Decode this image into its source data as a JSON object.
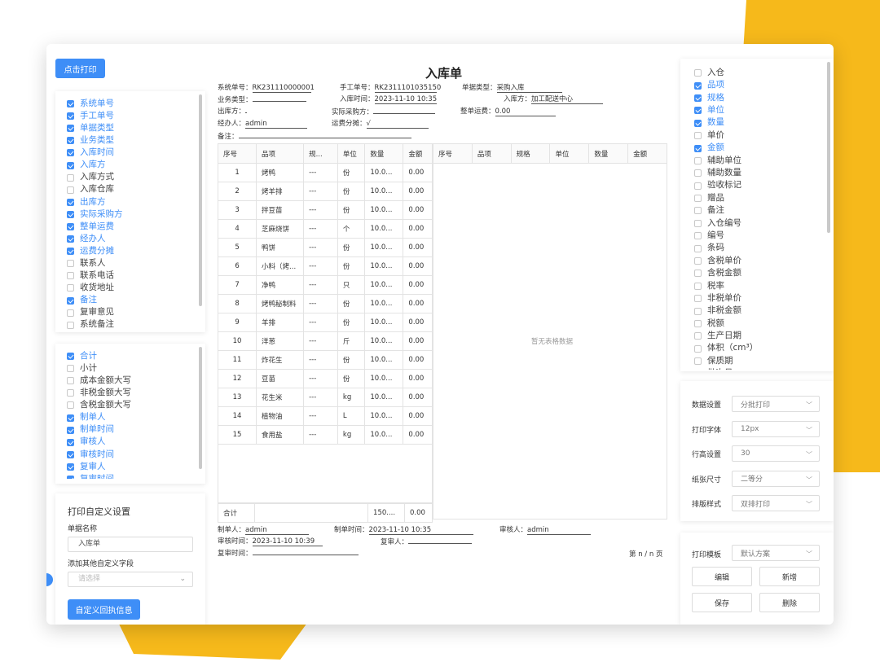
{
  "print_button": "点击打印",
  "left_top_list": [
    {
      "label": "系统单号",
      "on": true
    },
    {
      "label": "手工单号",
      "on": true
    },
    {
      "label": "单据类型",
      "on": true
    },
    {
      "label": "业务类型",
      "on": true
    },
    {
      "label": "入库时间",
      "on": true
    },
    {
      "label": "入库方",
      "on": true
    },
    {
      "label": "入库方式",
      "on": false
    },
    {
      "label": "入库仓库",
      "on": false
    },
    {
      "label": "出库方",
      "on": true
    },
    {
      "label": "实际采购方",
      "on": true
    },
    {
      "label": "整单运费",
      "on": true
    },
    {
      "label": "经办人",
      "on": true
    },
    {
      "label": "运费分摊",
      "on": true
    },
    {
      "label": "联系人",
      "on": false
    },
    {
      "label": "联系电话",
      "on": false
    },
    {
      "label": "收货地址",
      "on": false
    },
    {
      "label": "备注",
      "on": true
    },
    {
      "label": "复审意见",
      "on": false
    },
    {
      "label": "系统备注",
      "on": false
    }
  ],
  "left_bottom_list": [
    {
      "label": "合计",
      "on": true
    },
    {
      "label": "小计",
      "on": false
    },
    {
      "label": "成本金额大写",
      "on": false
    },
    {
      "label": "非税金额大写",
      "on": false
    },
    {
      "label": "含税金额大写",
      "on": false
    },
    {
      "label": "制单人",
      "on": true
    },
    {
      "label": "制单时间",
      "on": true
    },
    {
      "label": "审核人",
      "on": true
    },
    {
      "label": "审核时间",
      "on": true
    },
    {
      "label": "复审人",
      "on": true
    },
    {
      "label": "复审时间",
      "on": true
    }
  ],
  "custom": {
    "title": "打印自定义设置",
    "name_label": "单据名称",
    "name_value": "入库单",
    "extra_label": "添加其他自定义字段",
    "extra_placeholder": "请选择",
    "button": "自定义回执信息"
  },
  "doc": {
    "title": "入库单",
    "fields": {
      "sys_no_label": "系统单号：",
      "sys_no": "RK231110000001",
      "manual_no_label": "手工单号：",
      "manual_no": "RK2311101035150",
      "doc_type_label": "单据类型：",
      "doc_type": "采购入库",
      "biz_type_label": "业务类型：",
      "biz_type": "",
      "in_time_label": "入库时间：",
      "in_time": "2023-11-10 10:35",
      "in_party_label": "入库方：",
      "in_party": "加工配送中心",
      "out_party_label": "出库方：",
      "out_party": "",
      "buyer_label": "实际采购方：",
      "buyer": "",
      "freight_label": "整单运费：",
      "freight": "0.00",
      "handler_label": "经办人：",
      "handler": "admin",
      "freight_share_label": "运费分摊：",
      "freight_share": "√",
      "remark_label": "备注：",
      "remark": ""
    },
    "headers": [
      "序号",
      "品项",
      "规...",
      "单位",
      "数量",
      "金额"
    ],
    "headers2": [
      "序号",
      "品项",
      "规格",
      "单位",
      "数量",
      "金额"
    ],
    "rows": [
      [
        "1",
        "烤鸭",
        "---",
        "份",
        "10.0...",
        "0.00"
      ],
      [
        "2",
        "烤羊排",
        "---",
        "份",
        "10.0...",
        "0.00"
      ],
      [
        "3",
        "拌豆苗",
        "---",
        "份",
        "10.0...",
        "0.00"
      ],
      [
        "4",
        "芝麻烧饼",
        "---",
        "个",
        "10.0...",
        "0.00"
      ],
      [
        "5",
        "鸭饼",
        "---",
        "份",
        "10.0...",
        "0.00"
      ],
      [
        "6",
        "小料（烤...",
        "---",
        "份",
        "10.0...",
        "0.00"
      ],
      [
        "7",
        "净鸭",
        "---",
        "只",
        "10.0...",
        "0.00"
      ],
      [
        "8",
        "烤鸭秘制料",
        "---",
        "份",
        "10.0...",
        "0.00"
      ],
      [
        "9",
        "羊排",
        "---",
        "份",
        "10.0...",
        "0.00"
      ],
      [
        "10",
        "洋葱",
        "---",
        "斤",
        "10.0...",
        "0.00"
      ],
      [
        "11",
        "炸花生",
        "---",
        "份",
        "10.0...",
        "0.00"
      ],
      [
        "12",
        "豆苗",
        "---",
        "份",
        "10.0...",
        "0.00"
      ],
      [
        "13",
        "花生米",
        "---",
        "kg",
        "10.0...",
        "0.00"
      ],
      [
        "14",
        "植物油",
        "---",
        "L",
        "10.0...",
        "0.00"
      ],
      [
        "15",
        "食用盐",
        "---",
        "kg",
        "10.0...",
        "0.00"
      ]
    ],
    "total_label": "合计",
    "total_qty": "150....",
    "total_amount": "0.00",
    "empty_text": "暂无表格数据",
    "footer": {
      "maker_label": "制单人：",
      "maker": "admin",
      "make_time_label": "制单时间：",
      "make_time": "2023-11-10 10:35",
      "auditor_label": "审核人：",
      "auditor": "admin",
      "audit_time_label": "审核时间：",
      "audit_time": "2023-11-10 10:39",
      "reviewer_label": "复审人：",
      "reviewer": "",
      "review_time_label": "复审时间：",
      "review_time": "",
      "page": "第 n / n 页"
    }
  },
  "right_list": [
    {
      "label": "入仓",
      "on": false
    },
    {
      "label": "品项",
      "on": true
    },
    {
      "label": "规格",
      "on": true
    },
    {
      "label": "单位",
      "on": true
    },
    {
      "label": "数量",
      "on": true
    },
    {
      "label": "单价",
      "on": false
    },
    {
      "label": "金额",
      "on": true
    },
    {
      "label": "辅助单位",
      "on": false
    },
    {
      "label": "辅助数量",
      "on": false
    },
    {
      "label": "验收标记",
      "on": false
    },
    {
      "label": "赠品",
      "on": false
    },
    {
      "label": "备注",
      "on": false
    },
    {
      "label": "入仓编号",
      "on": false
    },
    {
      "label": "编号",
      "on": false
    },
    {
      "label": "条码",
      "on": false
    },
    {
      "label": "含税单价",
      "on": false
    },
    {
      "label": "含税金额",
      "on": false
    },
    {
      "label": "税率",
      "on": false
    },
    {
      "label": "非税单价",
      "on": false
    },
    {
      "label": "非税金额",
      "on": false
    },
    {
      "label": "税额",
      "on": false
    },
    {
      "label": "生产日期",
      "on": false
    },
    {
      "label": "体积（cm³）",
      "on": false
    },
    {
      "label": "保质期",
      "on": false
    },
    {
      "label": "批次号",
      "on": false
    }
  ],
  "settings": [
    {
      "label": "数据设置",
      "value": "分批打印"
    },
    {
      "label": "打印字体",
      "value": "12px"
    },
    {
      "label": "行高设置",
      "value": "30"
    },
    {
      "label": "纸张尺寸",
      "value": "二等分"
    },
    {
      "label": "排版样式",
      "value": "双排打印"
    }
  ],
  "template": {
    "label": "打印模板",
    "value": "默认方案",
    "edit": "编辑",
    "add": "新增",
    "save": "保存",
    "delete": "删除"
  },
  "colors": {
    "accent": "#3e8ef7",
    "brand_yellow": "#f6b91b"
  }
}
